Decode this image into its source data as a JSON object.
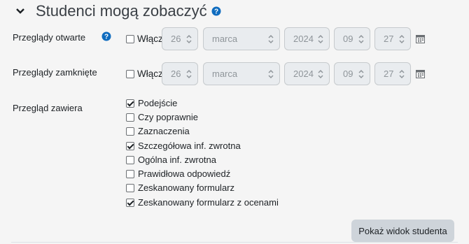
{
  "section": {
    "title": "Studenci mogą zobaczyć"
  },
  "rows": {
    "open": {
      "label": "Przeglądy otwarte",
      "enable_label": "Włącz",
      "day": "26",
      "month": "marca",
      "year": "2024",
      "hour": "09",
      "minute": "27"
    },
    "closed": {
      "label": "Przeglądy zamknięte",
      "enable_label": "Włącz",
      "day": "26",
      "month": "marca",
      "year": "2024",
      "hour": "09",
      "minute": "27"
    }
  },
  "contents": {
    "label": "Przegląd zawiera",
    "options": [
      {
        "label": "Podejście",
        "checked": true
      },
      {
        "label": "Czy poprawnie",
        "checked": false
      },
      {
        "label": "Zaznaczenia",
        "checked": false
      },
      {
        "label": "Szczegółowa inf. zwrotna",
        "checked": true
      },
      {
        "label": "Ogólna inf. zwrotna",
        "checked": false
      },
      {
        "label": "Prawidłowa odpowiedź",
        "checked": false
      },
      {
        "label": "Zeskanowany formularz",
        "checked": false
      },
      {
        "label": "Zeskanowany formularz z ocenami",
        "checked": true
      }
    ]
  },
  "button": {
    "label": "Pokaż widok studenta"
  },
  "colors": {
    "help": "#0f6cbf",
    "disabled_bg": "#e9ecef",
    "button_bg": "#ced4da"
  }
}
